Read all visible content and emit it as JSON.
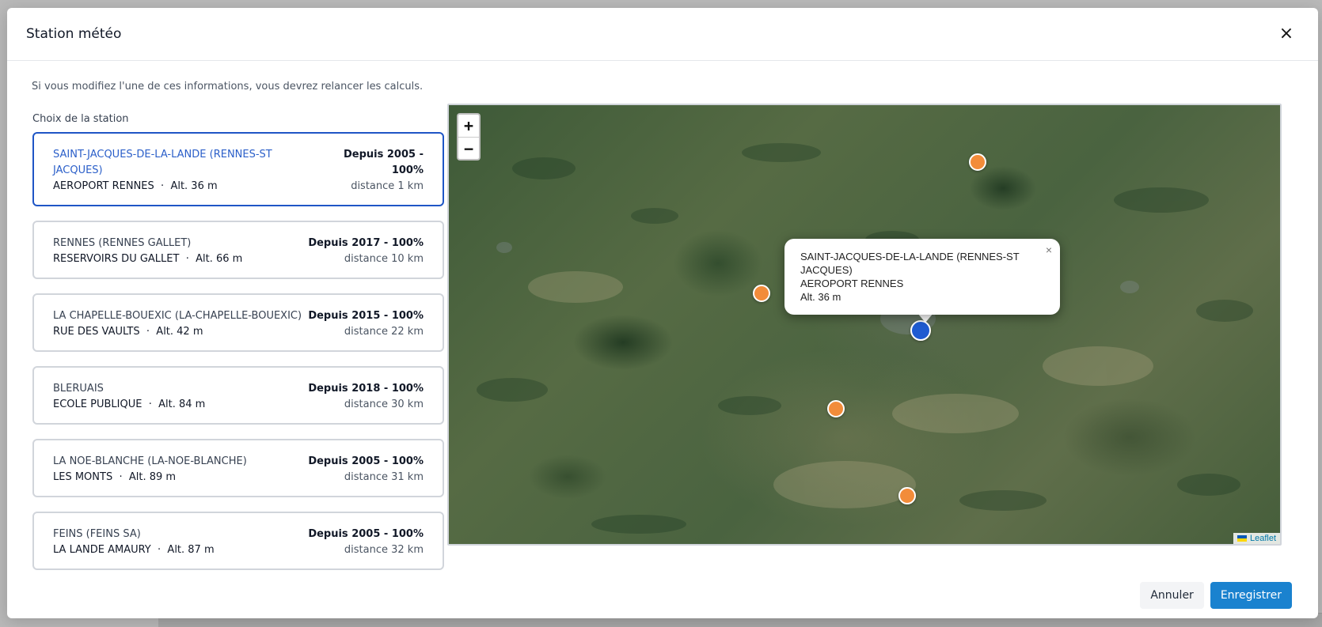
{
  "modal": {
    "title": "Station météo",
    "close_label": "×",
    "notice": "Si vous modifiez l'une de ces informations, vous devrez relancer les calculs.",
    "section_label": "Choix de la station"
  },
  "stations": [
    {
      "name": "SAINT-JACQUES-DE-LA-LANDE (RENNES-ST JACQUES)",
      "place": "AEROPORT RENNES",
      "altitude": "Alt. 36 m",
      "since": "Depuis 2005 - 100%",
      "distance": "distance 1 km",
      "selected": true
    },
    {
      "name": "RENNES (RENNES GALLET)",
      "place": "RESERVOIRS DU GALLET",
      "altitude": "Alt. 66 m",
      "since": "Depuis 2017 - 100%",
      "distance": "distance 10 km",
      "selected": false
    },
    {
      "name": "LA CHAPELLE-BOUEXIC (LA-CHAPELLE-BOUEXIC)",
      "place": "RUE DES VAULTS",
      "altitude": "Alt. 42 m",
      "since": "Depuis 2015 - 100%",
      "distance": "distance 22 km",
      "selected": false
    },
    {
      "name": "BLERUAIS",
      "place": "ECOLE PUBLIQUE",
      "altitude": "Alt. 84 m",
      "since": "Depuis 2018 - 100%",
      "distance": "distance 30 km",
      "selected": false
    },
    {
      "name": "LA NOE-BLANCHE (LA-NOE-BLANCHE)",
      "place": "LES MONTS",
      "altitude": "Alt. 89 m",
      "since": "Depuis 2005 - 100%",
      "distance": "distance 31 km",
      "selected": false
    },
    {
      "name": "FEINS (FEINS SA)",
      "place": "LA LANDE AMAURY",
      "altitude": "Alt. 87 m",
      "since": "Depuis 2005 - 100%",
      "distance": "distance 32 km",
      "selected": false
    }
  ],
  "map": {
    "zoom_in": "+",
    "zoom_out": "−",
    "popup": {
      "line1": "SAINT-JACQUES-DE-LA-LANDE (RENNES-ST JACQUES)",
      "line2": "AEROPORT RENNES",
      "line3": "Alt. 36 m",
      "close": "×"
    },
    "attribution": "Leaflet",
    "marker_color": "#f28c3a",
    "selected_marker_color": "#1f5bd1"
  },
  "footer": {
    "cancel": "Annuler",
    "save": "Enregistrer"
  },
  "colors": {
    "accent": "#1a82cf",
    "selected_border": "#1f56c6"
  }
}
